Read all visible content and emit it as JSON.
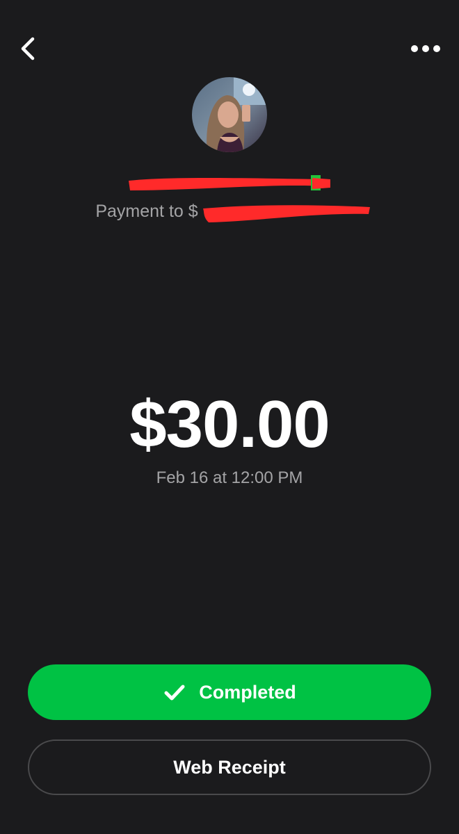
{
  "header": {
    "back_icon": "chevron-left-icon",
    "more_icon": "more-horizontal-icon"
  },
  "recipient": {
    "name": "",
    "payment_prefix": "Payment to $",
    "avatar_icon": "profile-photo"
  },
  "transaction": {
    "amount": "$30.00",
    "date": "Feb 16 at 12:00 PM"
  },
  "actions": {
    "status_label": "Completed",
    "status_icon": "check-icon",
    "receipt_label": "Web Receipt"
  },
  "colors": {
    "background": "#1b1b1d",
    "accent_green": "#00c244",
    "secondary_text": "#a4a4a6",
    "redaction": "#ff2a2a"
  }
}
